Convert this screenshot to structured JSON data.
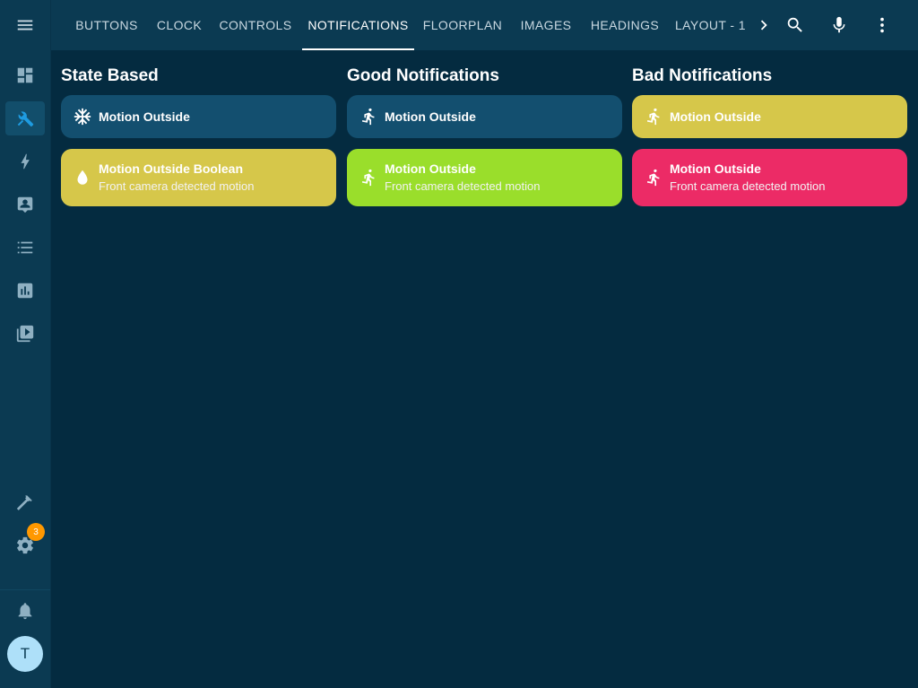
{
  "colors": {
    "background": "#042b40",
    "sidebar": "#0b3a52",
    "card_blue": "#134f6f",
    "card_yellow": "#d6c74a",
    "card_green": "#9ade2b",
    "card_pink": "#ec2b66",
    "accent": "#1e9be0",
    "badge": "#ff9800"
  },
  "sidebar": {
    "menu_icon": "menu-icon",
    "items": [
      {
        "icon": "dashboard-icon"
      },
      {
        "icon": "tools-icon",
        "active": true
      },
      {
        "icon": "lightning-icon"
      },
      {
        "icon": "contact-card-icon"
      },
      {
        "icon": "list-icon"
      },
      {
        "icon": "chart-box-icon"
      },
      {
        "icon": "media-icon"
      }
    ],
    "bottom_items": [
      {
        "icon": "hammer-icon"
      },
      {
        "icon": "gear-icon",
        "badge": "3"
      }
    ],
    "notifications_icon": "bell-icon",
    "avatar_initial": "T"
  },
  "tabs": [
    {
      "label": "BUTTONS"
    },
    {
      "label": "CLOCK"
    },
    {
      "label": "CONTROLS"
    },
    {
      "label": "NOTIFICATIONS",
      "active": true
    },
    {
      "label": "FLOORPLAN"
    },
    {
      "label": "IMAGES"
    },
    {
      "label": "HEADINGS"
    },
    {
      "label": "LAYOUT - 1"
    }
  ],
  "toolbar": {
    "next_icon": "chevron-right-icon",
    "search_icon": "search-icon",
    "mic_icon": "microphone-icon",
    "more_icon": "more-vertical-icon"
  },
  "columns": [
    {
      "title": "State Based",
      "cards": [
        {
          "icon": "snowflake-icon",
          "title": "Motion Outside",
          "subtitle": "",
          "color": "blue"
        },
        {
          "icon": "water-drop-icon",
          "title": "Motion Outside Boolean",
          "subtitle": "Front camera detected motion",
          "color": "yellow"
        }
      ]
    },
    {
      "title": "Good Notifications",
      "cards": [
        {
          "icon": "walking-person-icon",
          "title": "Motion Outside",
          "subtitle": "",
          "color": "blue"
        },
        {
          "icon": "walking-person-icon",
          "title": "Motion Outside",
          "subtitle": "Front camera detected motion",
          "color": "green"
        }
      ]
    },
    {
      "title": "Bad Notifications",
      "cards": [
        {
          "icon": "walking-person-icon",
          "title": "Motion Outside",
          "subtitle": "",
          "color": "yellow"
        },
        {
          "icon": "walking-person-icon",
          "title": "Motion Outside",
          "subtitle": "Front camera detected motion",
          "color": "pink"
        }
      ]
    }
  ]
}
